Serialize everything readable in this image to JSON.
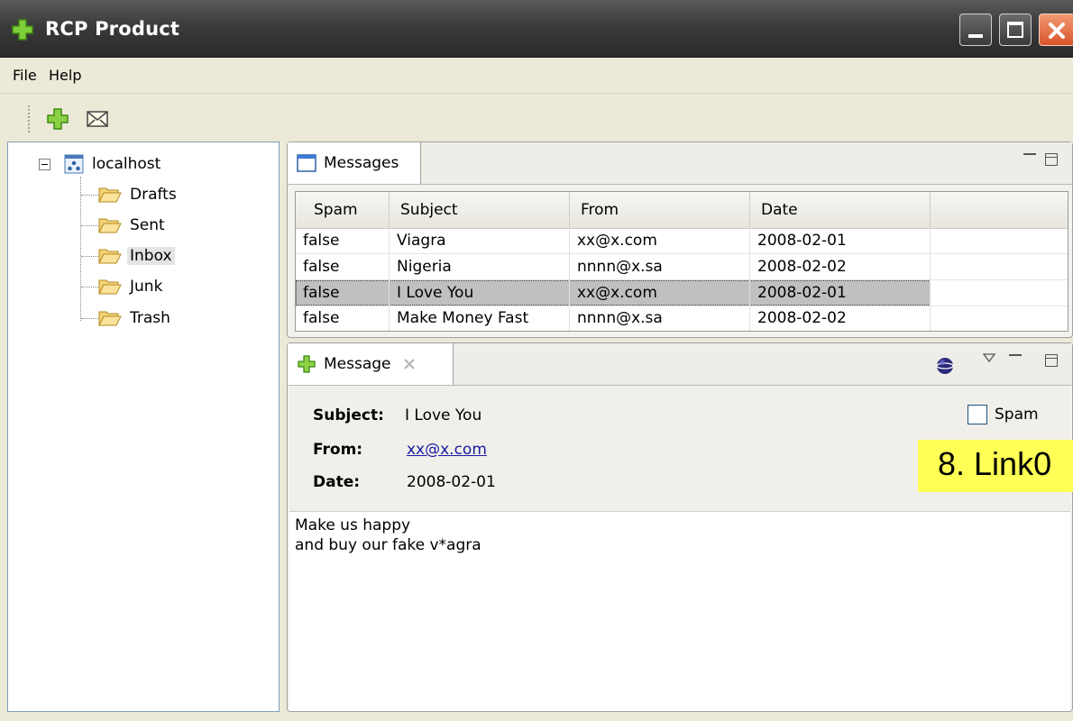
{
  "window": {
    "title": "RCP Product"
  },
  "menu": {
    "file": "File",
    "help": "Help"
  },
  "toolbar": {
    "buttons": [
      "add-icon",
      "mail-icon"
    ]
  },
  "tree": {
    "root": "localhost",
    "folders": [
      "Drafts",
      "Sent",
      "Inbox",
      "Junk",
      "Trash"
    ],
    "selected": "Inbox"
  },
  "messages_view": {
    "tab_label": "Messages",
    "columns": [
      "Spam",
      "Subject",
      "From",
      "Date"
    ],
    "rows": [
      {
        "spam": "false",
        "subject": "Viagra",
        "from": "xx@x.com",
        "date": "2008-02-01"
      },
      {
        "spam": "false",
        "subject": "Nigeria",
        "from": "nnnn@x.sa",
        "date": "2008-02-02"
      },
      {
        "spam": "false",
        "subject": "I Love You",
        "from": "xx@x.com",
        "date": "2008-02-01"
      },
      {
        "spam": "false",
        "subject": "Make Money Fast",
        "from": "nnnn@x.sa",
        "date": "2008-02-02"
      }
    ],
    "selected_row": 2
  },
  "message_view": {
    "tab_label": "Message",
    "subject_label": "Subject:",
    "subject_value": "I Love You",
    "from_label": "From:",
    "from_value": "xx@x.com",
    "date_label": "Date:",
    "date_value": "2008-02-01",
    "spam_label": "Spam",
    "spam_checked": false,
    "body": "Make us happy\nand buy our fake v*agra"
  },
  "annotation": {
    "text": "8. Link0"
  },
  "colors": {
    "link": "#1a1aa6",
    "annotation_bg": "#ffff55",
    "selection": "#c0c0c0"
  }
}
